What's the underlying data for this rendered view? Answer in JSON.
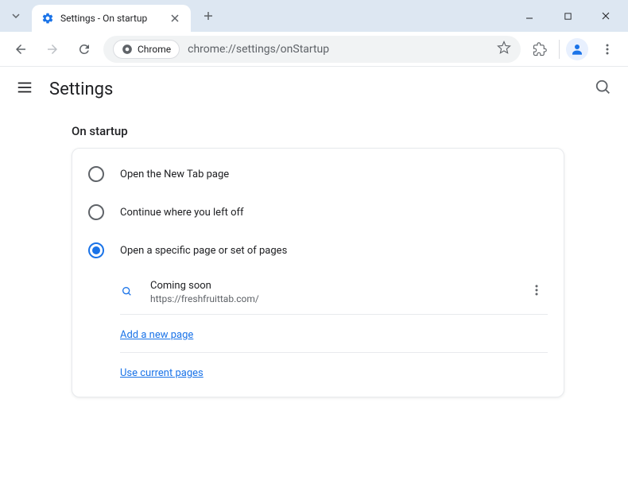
{
  "window": {
    "tab_title": "Settings - On startup"
  },
  "toolbar": {
    "chrome_label": "Chrome",
    "url": "chrome://settings/onStartup"
  },
  "settings": {
    "header_title": "Settings",
    "section_title": "On startup",
    "options": [
      {
        "label": "Open the New Tab page",
        "selected": false
      },
      {
        "label": "Continue where you left off",
        "selected": false
      },
      {
        "label": "Open a specific page or set of pages",
        "selected": true
      }
    ],
    "startup_page": {
      "title": "Coming soon",
      "url": "https://freshfruittab.com/"
    },
    "add_page_label": "Add a new page",
    "use_current_label": "Use current pages"
  }
}
